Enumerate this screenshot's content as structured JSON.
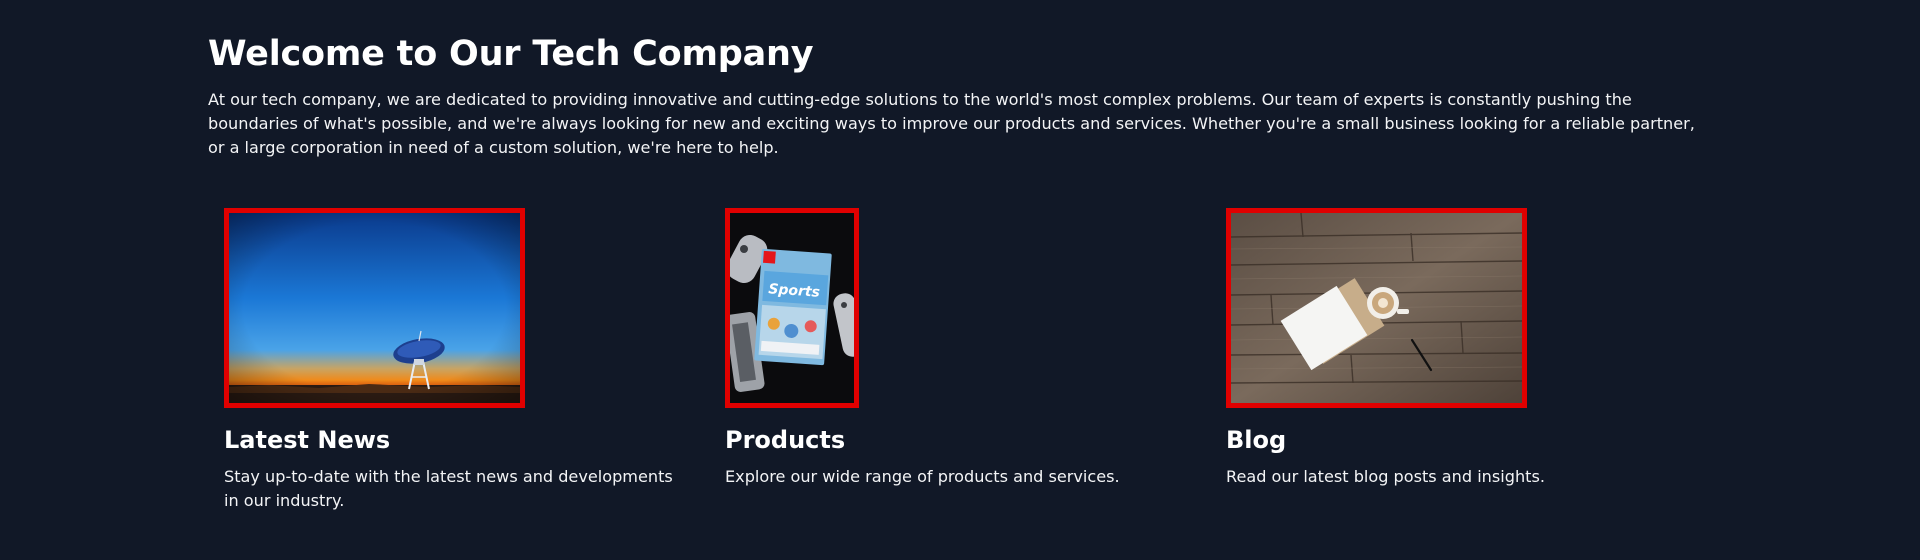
{
  "page": {
    "title": "Welcome to Our Tech Company",
    "intro": "At our tech company, we are dedicated to providing innovative and cutting-edge solutions to the world's most complex problems. Our team of experts is constantly pushing the boundaries of what's possible, and we're always looking for new and exciting ways to improve our products and services. Whether you're a small business looking for a reliable partner, or a large corporation in need of a custom solution, we're here to help."
  },
  "cards": [
    {
      "title": "Latest News",
      "description": "Stay up-to-date with the latest news and developments in our industry."
    },
    {
      "title": "Products",
      "description": "Explore our wide range of products and services."
    },
    {
      "title": "Blog",
      "description": "Read our latest blog posts and insights."
    }
  ],
  "colors": {
    "background": "#111827",
    "text": "#ffffff",
    "image_border": "#e00000"
  }
}
